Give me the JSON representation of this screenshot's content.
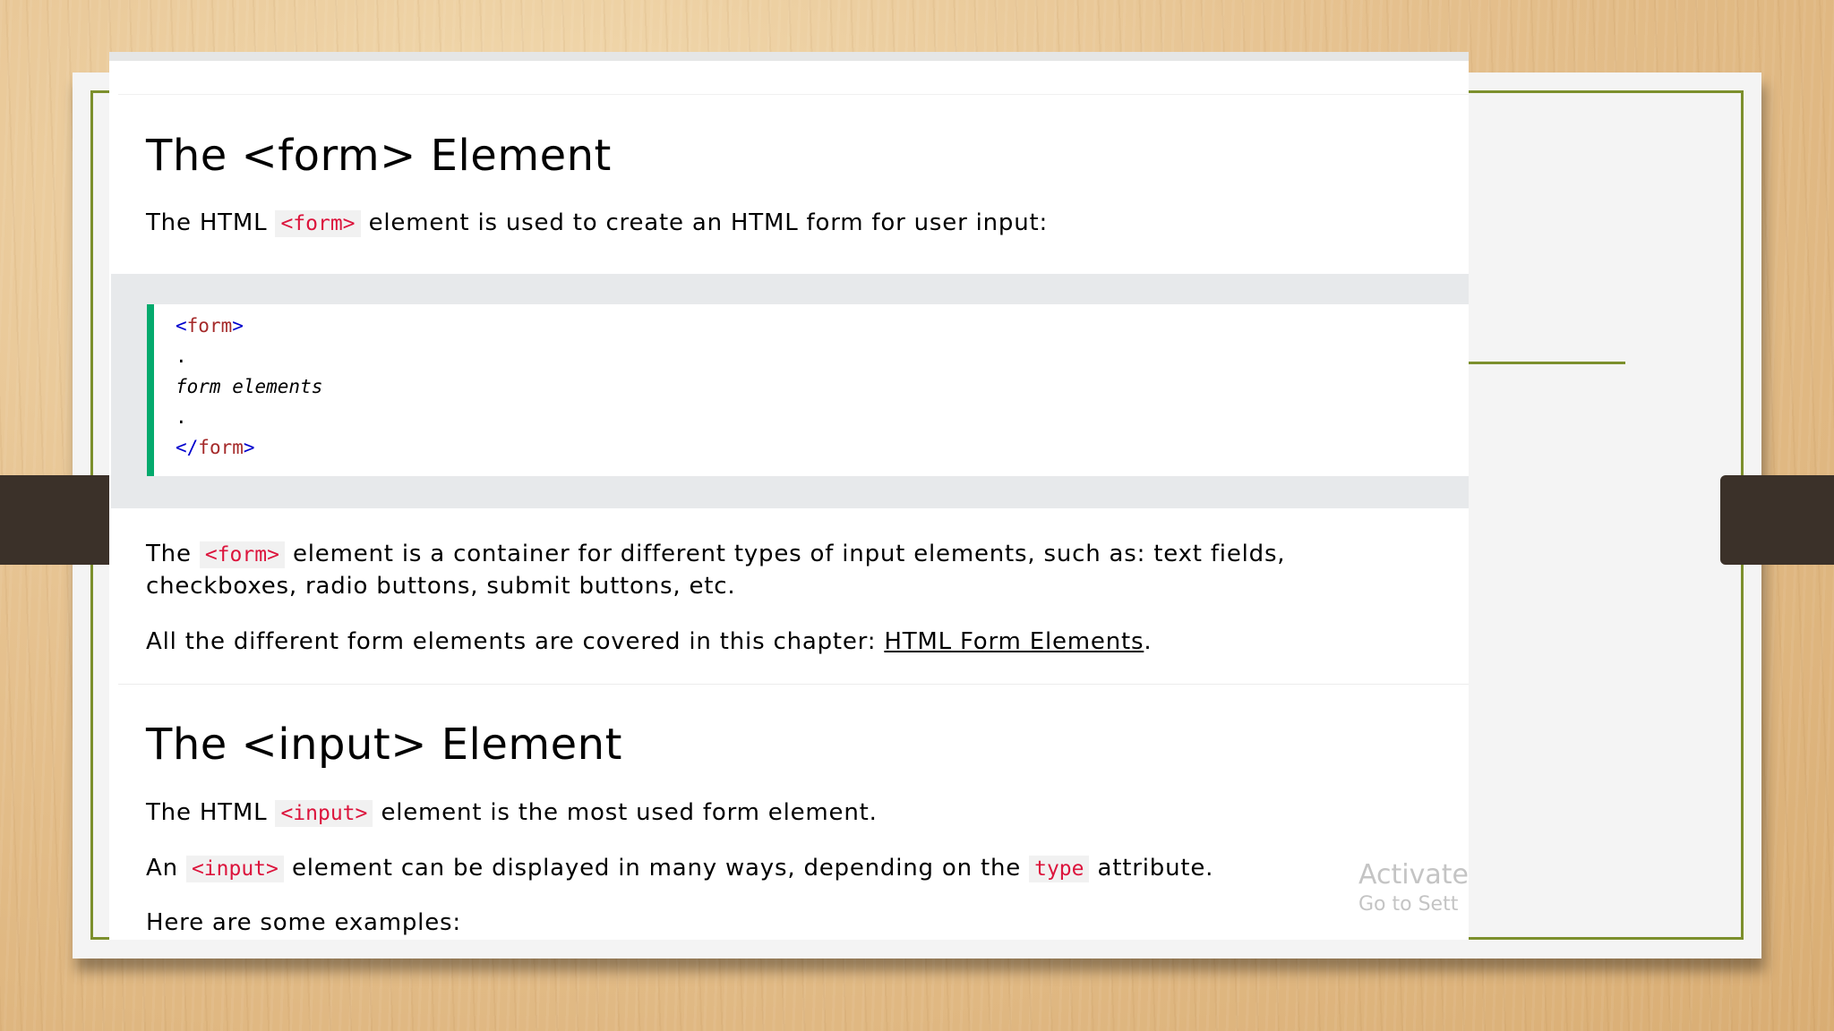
{
  "section_form": {
    "heading": "The <form> Element",
    "intro_before": "The HTML ",
    "intro_code": "<form>",
    "intro_after": " element is used to create an HTML form for user input:",
    "code": {
      "line1_open": "<",
      "line1_name": "form",
      "line1_close": ">",
      "line2": ".",
      "line3": "form elements",
      "line4": ".",
      "line5_open": "</",
      "line5_name": "form",
      "line5_close": ">"
    },
    "desc_before": "The ",
    "desc_code": "<form>",
    "desc_after": " element is a container for different types of input elements, such as: text fields, checkboxes, radio buttons, submit buttons, etc.",
    "covered_before": "All the different form elements are covered in this chapter: ",
    "covered_link": "HTML Form Elements",
    "covered_after": "."
  },
  "section_input": {
    "heading": "The <input> Element",
    "p1_before": "The HTML ",
    "p1_code": "<input>",
    "p1_after": " element is the most used form element.",
    "p2_before": "An ",
    "p2_code": "<input>",
    "p2_mid": " element can be displayed in many ways, depending on the ",
    "p2_code2": "type",
    "p2_after": " attribute.",
    "p3": "Here are some examples:"
  },
  "watermark": {
    "line1": "Activate",
    "line2": "Go to Sett"
  },
  "colors": {
    "code_accent": "#04aa6d",
    "inline_code": "#dc143c",
    "frame": "#7c8f2c"
  }
}
